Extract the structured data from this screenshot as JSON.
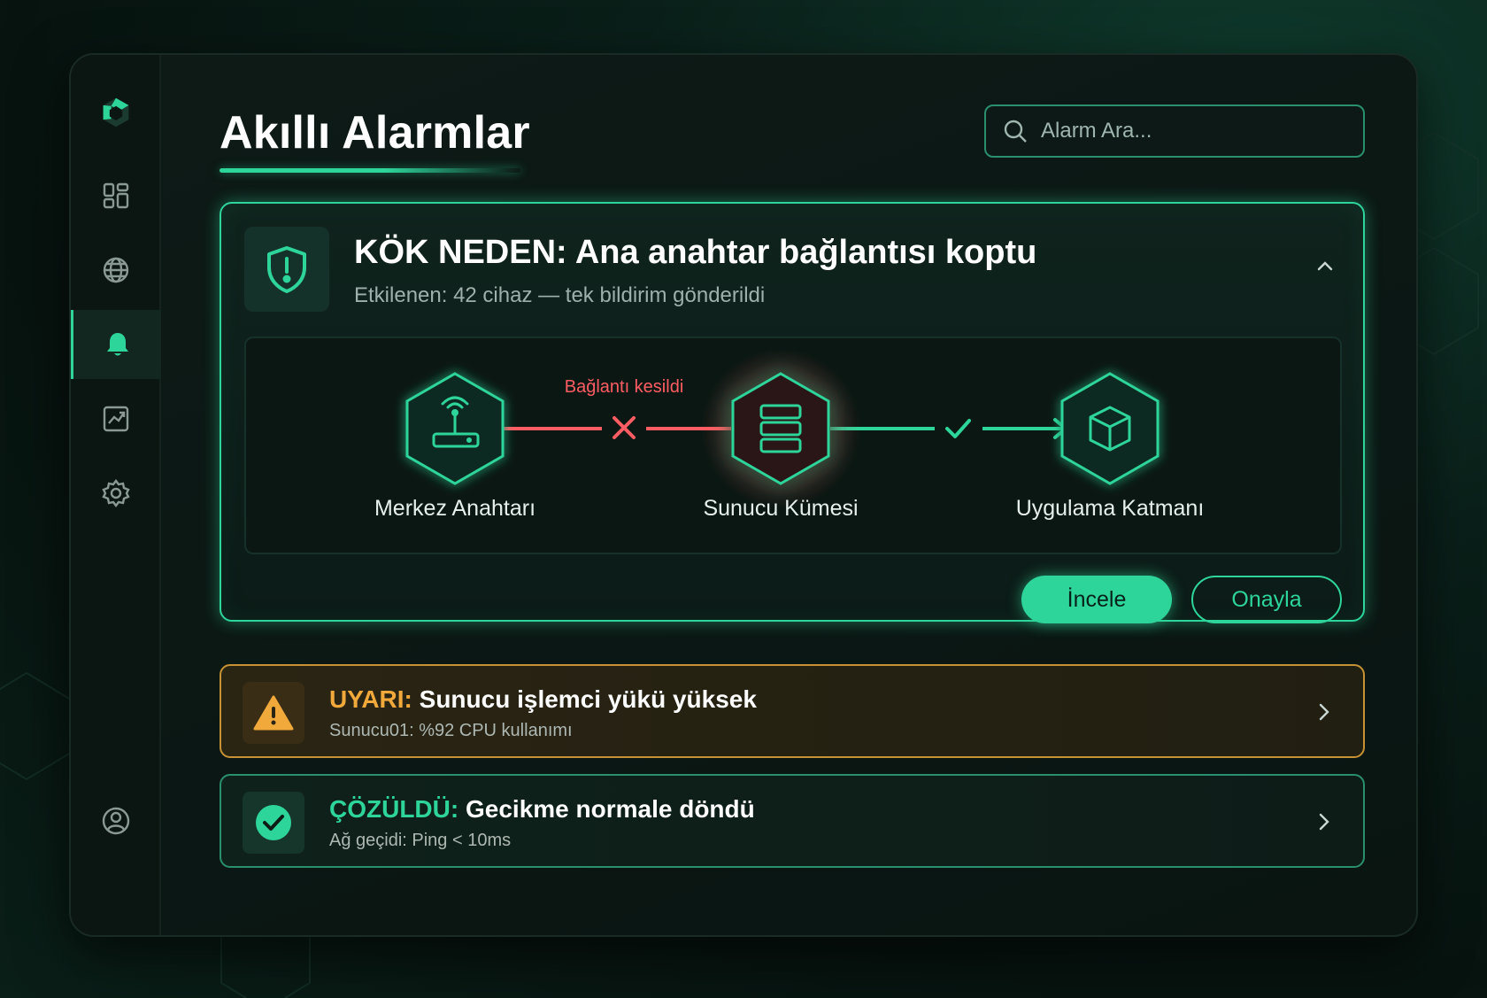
{
  "page": {
    "title": "Akıllı Alarmlar"
  },
  "search": {
    "placeholder": "Alarm Ara..."
  },
  "sidebar": {
    "items": [
      {
        "icon": "dashboard-icon",
        "active": false
      },
      {
        "icon": "globe-icon",
        "active": false
      },
      {
        "icon": "bell-icon",
        "active": true
      },
      {
        "icon": "chart-icon",
        "active": false
      },
      {
        "icon": "gear-icon",
        "active": false
      }
    ],
    "footer_icon": "user-icon",
    "logo_icon": "hexagon-logo-icon"
  },
  "root_cause": {
    "title": "KÖK NEDEN: Ana anahtar bağlantısı koptu",
    "subtitle": "Etkilenen: 42 cihaz — tek bildirim gönderildi",
    "icon": "shield-alert-icon",
    "diagram": {
      "nodes": [
        {
          "label": "Merkez Anahtarı",
          "icon": "router-icon",
          "status": "ok"
        },
        {
          "label": "Sunucu Kümesi",
          "icon": "server-icon",
          "status": "error"
        },
        {
          "label": "Uygulama Katmanı",
          "icon": "cube-icon",
          "status": "ok"
        }
      ],
      "links": [
        {
          "label": "Bağlantı kesildi",
          "status": "broken"
        },
        {
          "label": "",
          "status": "ok"
        }
      ]
    },
    "actions": {
      "inspect_label": "İncele",
      "acknowledge_label": "Onayla"
    }
  },
  "alerts": [
    {
      "type": "warning",
      "prefix": "UYARI:",
      "title": "Sunucu işlemci yükü yüksek",
      "subtitle": "Sunucu01: %92 CPU kullanımı",
      "icon": "warning-triangle-icon"
    },
    {
      "type": "resolved",
      "prefix": "ÇÖZÜLDÜ:",
      "title": "Gecikme normale döndü",
      "subtitle": "Ağ geçidi: Ping < 10ms",
      "icon": "check-circle-icon"
    }
  ],
  "colors": {
    "accent": "#2ed59b",
    "error": "#ff5d63",
    "warning": "#f2a93b",
    "background": "#0a1512"
  }
}
